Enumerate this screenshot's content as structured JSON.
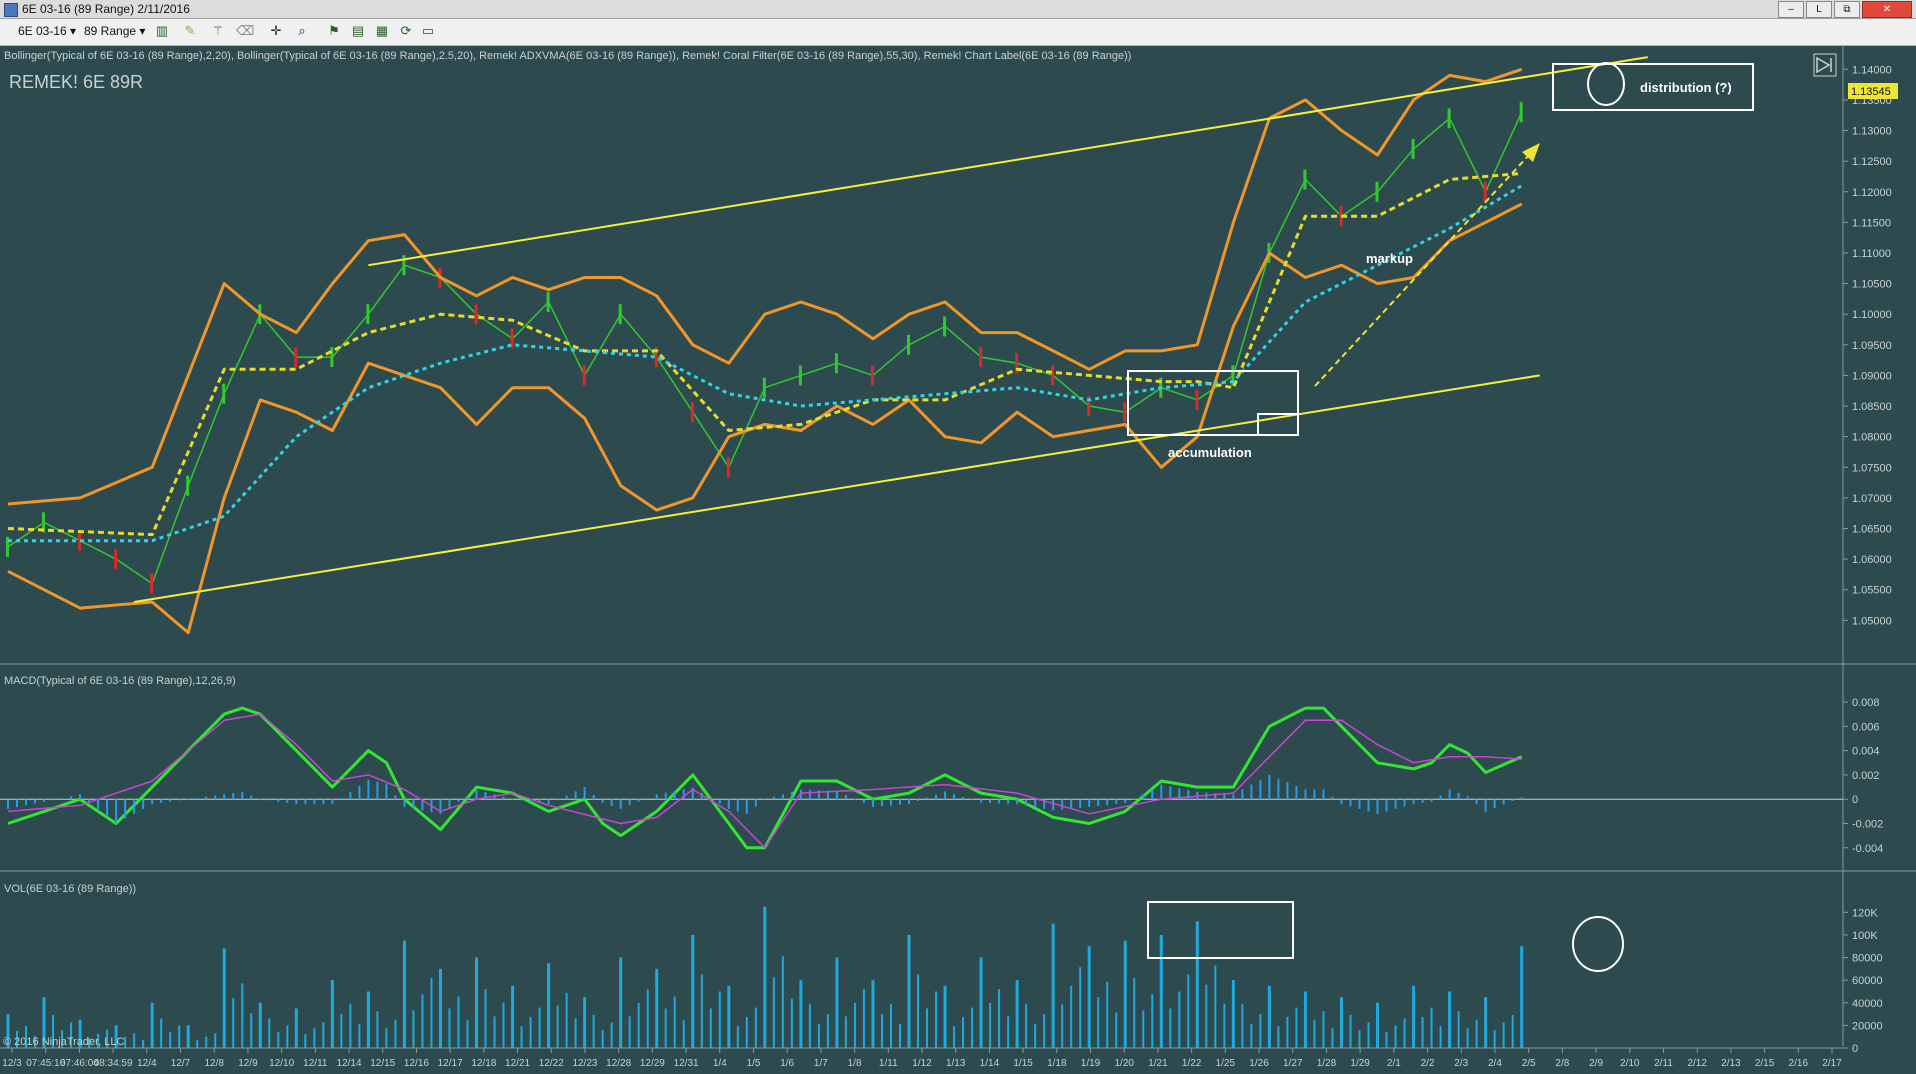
{
  "window": {
    "title": "6E 03-16 (89 Range)  2/11/2016",
    "controls": [
      "‒",
      "L",
      "⧉",
      "✕"
    ]
  },
  "toolbar": {
    "instrument": "6E 03-16",
    "interval": "89 Range",
    "icons": [
      "bar-style-icon",
      "draw-pen-icon",
      "magic-wand-icon",
      "eraser-icon",
      "crosshair-icon",
      "zoom-icon",
      "strategy-icon",
      "indicator-icon",
      "chart-properties-icon",
      "refresh-icon",
      "template-icon"
    ]
  },
  "colors": {
    "background": "#2d4a4e",
    "panel_background": "#2d4a4e",
    "axis_text": "#c8d2d2",
    "yellow_channel": "#f5f03c",
    "bollinger_outer": "#f0962a",
    "bollinger_inner": "#b8c0c0",
    "cyan_ma": "#32d2e6",
    "yellow_ma": "#e6dc2a",
    "candle_up": "#32c832",
    "candle_down": "#dc2828",
    "macd_line": "#32e632",
    "signal_line": "#c846d2",
    "histogram": "#2a9be6",
    "volume": "#1eaadc",
    "annotation": "#ffffff",
    "last_price_tag": "#f0e632"
  },
  "price_panel": {
    "indicator_label": "Bollinger(Typical of 6E 03-16 (89 Range),2,20), Bollinger(Typical of 6E 03-16 (89 Range),2.5,20), Remek! ADXVMA(6E 03-16 (89 Range)), Remek! Coral Filter(6E 03-16 (89 Range),55,30), Remek! Chart Label(6E 03-16 (89 Range))",
    "chart_label": "REMEK! 6E 89R",
    "last_price": "1.13545"
  },
  "annotations": {
    "distribution": "distribution (?)",
    "markup": "markup",
    "accumulation": "accumulation"
  },
  "macd_panel": {
    "label": "MACD(Typical of 6E 03-16 (89 Range),12,26,9)"
  },
  "volume_panel": {
    "label": "VOL(6E 03-16 (89 Range))"
  },
  "copyright": "© 2016 NinjaTrader, LLC",
  "chart_data": [
    {
      "type": "line",
      "panel": "price",
      "y_ticks": [
        "1.14000",
        "1.13500",
        "1.13000",
        "1.12500",
        "1.12000",
        "1.11500",
        "1.11000",
        "1.10500",
        "1.10000",
        "1.09500",
        "1.09000",
        "1.08500",
        "1.08000",
        "1.07500",
        "1.07000",
        "1.06500",
        "1.06000",
        "1.05500",
        "1.05000"
      ],
      "ylim": [
        1.0445,
        1.1425
      ],
      "xlim": [
        0,
        100
      ],
      "last_value": 1.13545,
      "series": [
        {
          "role": "price",
          "x": [
            0,
            2,
            4,
            6,
            8,
            10,
            12,
            14,
            16,
            18,
            20,
            22,
            24,
            26,
            28,
            30,
            32,
            34,
            36,
            38,
            40,
            42,
            44,
            46,
            48,
            50,
            52,
            54,
            56,
            58,
            60,
            62,
            64,
            66,
            68,
            70,
            72,
            74,
            76,
            78,
            80,
            82,
            84
          ],
          "y": [
            1.062,
            1.066,
            1.063,
            1.06,
            1.056,
            1.072,
            1.087,
            1.1,
            1.093,
            1.093,
            1.1,
            1.108,
            1.106,
            1.1,
            1.096,
            1.102,
            1.09,
            1.1,
            1.093,
            1.084,
            1.075,
            1.088,
            1.09,
            1.092,
            1.09,
            1.095,
            1.098,
            1.093,
            1.092,
            1.09,
            1.085,
            1.084,
            1.088,
            1.086,
            1.09,
            1.11,
            1.122,
            1.116,
            1.12,
            1.127,
            1.132,
            1.12,
            1.133
          ]
        },
        {
          "role": "bollinger-upper-2.5",
          "x": [
            0,
            4,
            8,
            10,
            12,
            14,
            16,
            18,
            20,
            22,
            24,
            26,
            28,
            30,
            32,
            34,
            36,
            38,
            40,
            42,
            44,
            46,
            48,
            50,
            52,
            54,
            56,
            58,
            60,
            62,
            64,
            66,
            68,
            70,
            72,
            74,
            76,
            78,
            80,
            82,
            84
          ],
          "y": [
            1.069,
            1.07,
            1.075,
            1.09,
            1.105,
            1.1,
            1.097,
            1.105,
            1.112,
            1.113,
            1.106,
            1.103,
            1.106,
            1.104,
            1.106,
            1.106,
            1.103,
            1.095,
            1.092,
            1.1,
            1.102,
            1.1,
            1.096,
            1.1,
            1.102,
            1.097,
            1.097,
            1.094,
            1.091,
            1.094,
            1.094,
            1.095,
            1.115,
            1.132,
            1.135,
            1.13,
            1.126,
            1.135,
            1.139,
            1.138,
            1.14
          ]
        },
        {
          "role": "bollinger-lower-2.5",
          "x": [
            0,
            4,
            8,
            10,
            12,
            14,
            16,
            18,
            20,
            22,
            24,
            26,
            28,
            30,
            32,
            34,
            36,
            38,
            40,
            42,
            44,
            46,
            48,
            50,
            52,
            54,
            56,
            58,
            60,
            62,
            64,
            66,
            68,
            70,
            72,
            74,
            76,
            78,
            80,
            82,
            84
          ],
          "y": [
            1.058,
            1.052,
            1.053,
            1.048,
            1.07,
            1.086,
            1.084,
            1.081,
            1.092,
            1.09,
            1.088,
            1.082,
            1.088,
            1.088,
            1.083,
            1.072,
            1.068,
            1.07,
            1.08,
            1.082,
            1.081,
            1.085,
            1.082,
            1.086,
            1.08,
            1.079,
            1.084,
            1.08,
            1.081,
            1.082,
            1.075,
            1.08,
            1.098,
            1.11,
            1.106,
            1.108,
            1.105,
            1.106,
            1.112,
            1.115,
            1.118
          ]
        },
        {
          "role": "adxvma",
          "x": [
            0,
            8,
            12,
            16,
            20,
            24,
            28,
            32,
            36,
            40,
            44,
            48,
            52,
            56,
            60,
            64,
            66,
            68,
            72,
            76,
            80,
            84
          ],
          "y": [
            1.065,
            1.064,
            1.091,
            1.091,
            1.097,
            1.1,
            1.099,
            1.094,
            1.094,
            1.081,
            1.082,
            1.086,
            1.086,
            1.091,
            1.09,
            1.089,
            1.089,
            1.088,
            1.116,
            1.116,
            1.122,
            1.123
          ]
        },
        {
          "role": "coral-filter",
          "x": [
            0,
            8,
            12,
            16,
            20,
            24,
            28,
            32,
            36,
            40,
            44,
            48,
            52,
            56,
            60,
            64,
            68,
            72,
            76,
            80,
            84
          ],
          "y": [
            1.063,
            1.063,
            1.067,
            1.08,
            1.088,
            1.092,
            1.095,
            1.094,
            1.093,
            1.087,
            1.085,
            1.086,
            1.087,
            1.088,
            1.086,
            1.088,
            1.089,
            1.102,
            1.108,
            1.114,
            1.121
          ]
        },
        {
          "role": "channel-upper",
          "x": [
            20,
            91
          ],
          "y": [
            1.108,
            1.142
          ]
        },
        {
          "role": "channel-lower",
          "x": [
            7,
            85
          ],
          "y": [
            1.053,
            1.09
          ]
        }
      ]
    },
    {
      "type": "line",
      "panel": "macd",
      "y_ticks": [
        "0.008",
        "0.006",
        "0.004",
        "0.002",
        "0",
        "-0.002",
        "-0.004"
      ],
      "ylim": [
        -0.0055,
        0.0085
      ],
      "xlim": [
        0,
        100
      ],
      "series": [
        {
          "role": "macd",
          "x": [
            0,
            2,
            4,
            6,
            8,
            10,
            12,
            13,
            14,
            16,
            18,
            20,
            21,
            22,
            24,
            26,
            28,
            30,
            32,
            33,
            34,
            36,
            38,
            40,
            41,
            42,
            44,
            46,
            48,
            50,
            52,
            54,
            56,
            58,
            60,
            62,
            64,
            66,
            68,
            70,
            72,
            73,
            74,
            76,
            78,
            79,
            80,
            81,
            82,
            84
          ],
          "y": [
            -0.002,
            -0.001,
            0.0,
            -0.002,
            0.001,
            0.004,
            0.007,
            0.0075,
            0.007,
            0.004,
            0.001,
            0.004,
            0.003,
            0.0,
            -0.0025,
            0.001,
            0.0005,
            -0.001,
            0.0,
            -0.002,
            -0.003,
            -0.001,
            0.002,
            -0.002,
            -0.004,
            -0.004,
            0.0015,
            0.0015,
            0.0,
            0.0005,
            0.002,
            0.0005,
            0.0,
            -0.0015,
            -0.002,
            -0.001,
            0.0015,
            0.001,
            0.001,
            0.006,
            0.0075,
            0.0075,
            0.006,
            0.003,
            0.0025,
            0.003,
            0.0045,
            0.0038,
            0.0022,
            0.0035
          ]
        },
        {
          "role": "signal",
          "x": [
            0,
            4,
            8,
            12,
            14,
            16,
            18,
            20,
            22,
            24,
            26,
            28,
            30,
            34,
            36,
            38,
            40,
            42,
            44,
            48,
            52,
            56,
            60,
            64,
            68,
            72,
            74,
            76,
            78,
            80,
            82,
            84
          ],
          "y": [
            -0.001,
            -0.0005,
            0.0015,
            0.0065,
            0.007,
            0.0045,
            0.0015,
            0.002,
            0.0008,
            -0.001,
            0.0,
            0.0005,
            -0.0005,
            -0.002,
            -0.0015,
            0.0008,
            -0.001,
            -0.004,
            0.0005,
            0.0008,
            0.0012,
            0.0005,
            -0.0012,
            0.0,
            0.0005,
            0.0065,
            0.0065,
            0.0045,
            0.003,
            0.0035,
            0.0035,
            0.0033
          ]
        }
      ]
    },
    {
      "type": "bar",
      "panel": "volume",
      "y_ticks": [
        "120K",
        "100K",
        "80000",
        "60000",
        "40000",
        "20000",
        "0"
      ],
      "ylim": [
        0,
        130000
      ],
      "series": [
        {
          "name": "VOL",
          "x": [
            0,
            2,
            4,
            6,
            8,
            10,
            12,
            14,
            16,
            18,
            20,
            22,
            24,
            26,
            28,
            30,
            32,
            34,
            36,
            38,
            40,
            42,
            44,
            46,
            48,
            50,
            52,
            54,
            56,
            58,
            60,
            62,
            64,
            66,
            68,
            70,
            72,
            74,
            76,
            78,
            80,
            82,
            84
          ],
          "values": [
            30000,
            45000,
            25000,
            20000,
            40000,
            20000,
            88000,
            40000,
            35000,
            60000,
            50000,
            95000,
            70000,
            80000,
            55000,
            75000,
            45000,
            80000,
            70000,
            100000,
            55000,
            125000,
            60000,
            80000,
            60000,
            100000,
            55000,
            80000,
            60000,
            110000,
            90000,
            95000,
            100000,
            112000,
            60000,
            55000,
            50000,
            45000,
            40000,
            55000,
            50000,
            45000,
            90000
          ]
        }
      ]
    }
  ],
  "x_axis": {
    "labels": [
      "12/3",
      "07:45:16",
      "07:46:04",
      "08:34:59",
      "12/4",
      "12/7",
      "12/8",
      "12/9",
      "12/10",
      "12/11",
      "12/14",
      "12/15",
      "12/16",
      "12/17",
      "12/18",
      "12/21",
      "12/22",
      "12/23",
      "12/28",
      "12/29",
      "12/31",
      "1/4",
      "1/5",
      "1/6",
      "1/7",
      "1/8",
      "1/11",
      "1/12",
      "1/13",
      "1/14",
      "1/15",
      "1/18",
      "1/19",
      "1/20",
      "1/21",
      "1/22",
      "1/25",
      "1/26",
      "1/27",
      "1/28",
      "1/29",
      "2/1",
      "2/2",
      "2/3",
      "2/4",
      "2/5",
      "2/8",
      "2/9",
      "2/10",
      "2/11",
      "2/12",
      "2/13",
      "2/15",
      "2/16",
      "2/17"
    ]
  }
}
